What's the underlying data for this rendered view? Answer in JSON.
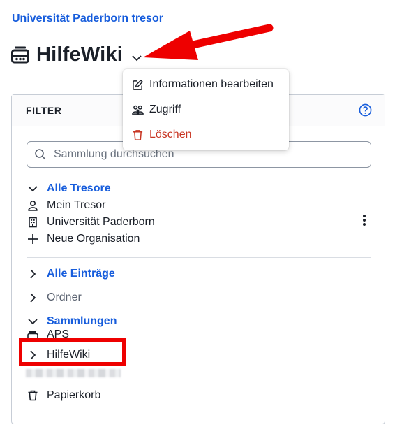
{
  "breadcrumb": "Universität Paderborn tresor",
  "header": {
    "title": "HilfeWiki",
    "icon": "collection-icon"
  },
  "menu": {
    "items": [
      {
        "label": "Informationen bearbeiten",
        "icon": "edit-icon"
      },
      {
        "label": "Zugriff",
        "icon": "users-icon"
      },
      {
        "label": "Löschen",
        "icon": "trash-icon",
        "color": "#c83522"
      }
    ]
  },
  "filter": {
    "title": "FILTER",
    "search_placeholder": "Sammlung durchsuchen",
    "vaults": {
      "label": "Alle Tresore",
      "items": [
        {
          "label": "Mein Tresor",
          "icon": "user-icon"
        },
        {
          "label": "Universität Paderborn",
          "icon": "building-icon"
        },
        {
          "label": "Neue Organisation",
          "icon": "plus-icon"
        }
      ]
    },
    "all_items": "Alle Einträge",
    "folders": "Ordner",
    "collections": {
      "label": "Sammlungen",
      "items": [
        {
          "label": "APS"
        },
        {
          "label": "HilfeWiki"
        }
      ]
    },
    "trash": "Papierkorb"
  },
  "colors": {
    "link": "#175ddc",
    "danger": "#c83522",
    "annotation": "#ee0000"
  }
}
